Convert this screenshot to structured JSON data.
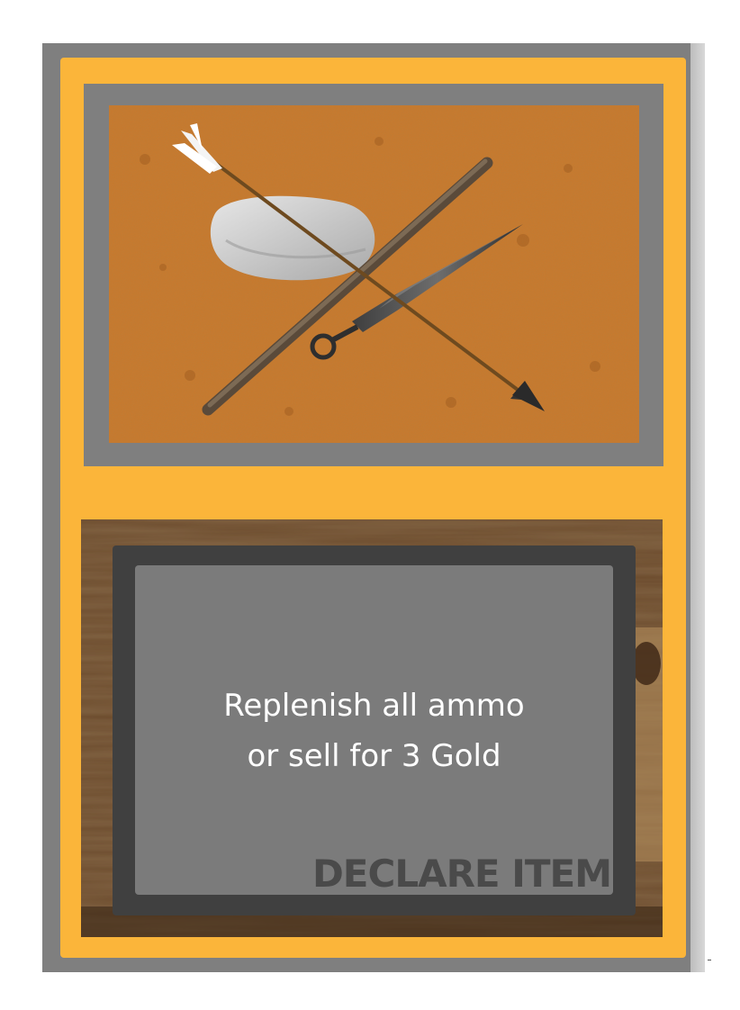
{
  "card": {
    "effect_lines": [
      "Replenish all ammo",
      "or sell for 3 Gold"
    ],
    "type_label": "DECLARE ITEM"
  },
  "art": {
    "icons": [
      "arrow-icon",
      "kunai-icon",
      "wooden-stick-icon",
      "stone-icon"
    ],
    "background": "sand-texture"
  },
  "colors": {
    "card_border": "#fbb53a",
    "frame_gray": "#7f7f7f",
    "text_frame": "#404040",
    "text_panel": "#7b7b7b",
    "sand": "#c8782a"
  }
}
